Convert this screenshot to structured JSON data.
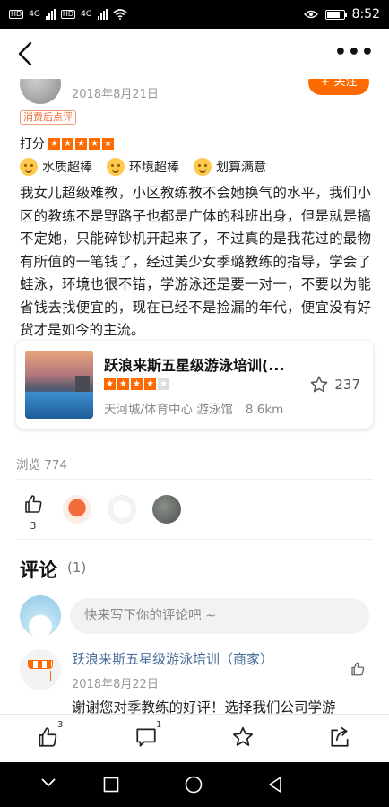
{
  "status": {
    "net1": "4G",
    "net2": "4G",
    "hd1": "HD",
    "hd2": "HD",
    "time": "8:52",
    "battery_level": 0.8
  },
  "header": {
    "more_label": "•••"
  },
  "author": {
    "date": "2018年8月21日",
    "follow_label": "+ 关注"
  },
  "review": {
    "tag": "消费后点评",
    "score_label": "打分",
    "rating": 5,
    "rating_max": 5,
    "features": [
      "水质超棒",
      "环境超棒",
      "划算满意"
    ],
    "text": "我女儿超级难教，小区教练教不会她换气的水平，我们小区的教练不是野路子也都是广体的科班出身，但是就是搞不定她，只能碎钞机开起来了，不过真的是我花过的最物有所值的一笔钱了，经过美少女季璐教练的指导，学会了蛙泳，环境也很不错，学游泳还是要一对一，不要以为能省钱去找便宜的，现在已经不是捡漏的年代，便宜没有好货才是如今的主流。"
  },
  "shop": {
    "name": "跃浪来斯五星级游泳培训(...",
    "rating": 4,
    "rating_max": 5,
    "area": "天河城/体育中心 游泳馆",
    "distance": "8.6km",
    "favorites": "237"
  },
  "stats": {
    "views": "浏览 774",
    "likes": "3"
  },
  "comments": {
    "title": "评论",
    "count": "(1)",
    "placeholder": "快来写下你的评论吧 ~",
    "reply": {
      "author": "跃浪来斯五星级游泳培训（商家）",
      "date": "2018年8月22日",
      "text": "谢谢您对季教练的好评！选择我们公司学游"
    }
  },
  "actions": {
    "like_count": "3",
    "comment_count": "1"
  }
}
